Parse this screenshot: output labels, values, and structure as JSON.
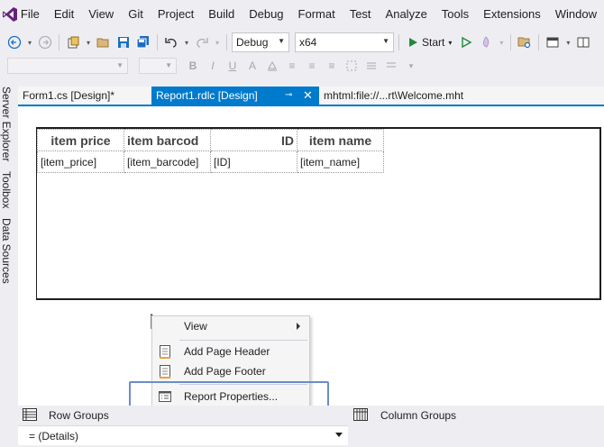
{
  "menubar": {
    "items": [
      "File",
      "Edit",
      "View",
      "Git",
      "Project",
      "Build",
      "Debug",
      "Format",
      "Test",
      "Analyze",
      "Tools",
      "Extensions",
      "Window"
    ]
  },
  "toolbar": {
    "configuration": "Debug",
    "platform": "x64",
    "start_label": "Start"
  },
  "format_toolbar": {
    "bold": "B",
    "italic": "I",
    "underline": "U",
    "font_color": "A"
  },
  "side_panels": [
    "Server Explorer",
    "Toolbox",
    "Data Sources"
  ],
  "tabs": [
    {
      "label": "Form1.cs [Design]*"
    },
    {
      "label": "Report1.rdlc [Design]",
      "active": true
    },
    {
      "label": "mhtml:file://...rt\\Welcome.mht"
    }
  ],
  "report_table": {
    "headers": [
      "item price",
      "item barcod",
      "ID",
      "item name"
    ],
    "row": [
      "[item_price]",
      "[item_barcode]",
      "[ID]",
      "[item_name]"
    ]
  },
  "context_menu": {
    "items": [
      {
        "label": "View",
        "has_submenu": true
      },
      {
        "label": "Add Page Header"
      },
      {
        "label": "Add Page Footer"
      },
      {
        "label": "Report Properties..."
      }
    ]
  },
  "grouping": {
    "row_groups_label": "Row Groups",
    "column_groups_label": "Column Groups",
    "details_label": "= (Details)"
  },
  "colors": {
    "accent": "#007acc",
    "highlight_border": "#6b8cc9",
    "play_green": "#1e8a3a",
    "vs_purple": "#68217a"
  }
}
